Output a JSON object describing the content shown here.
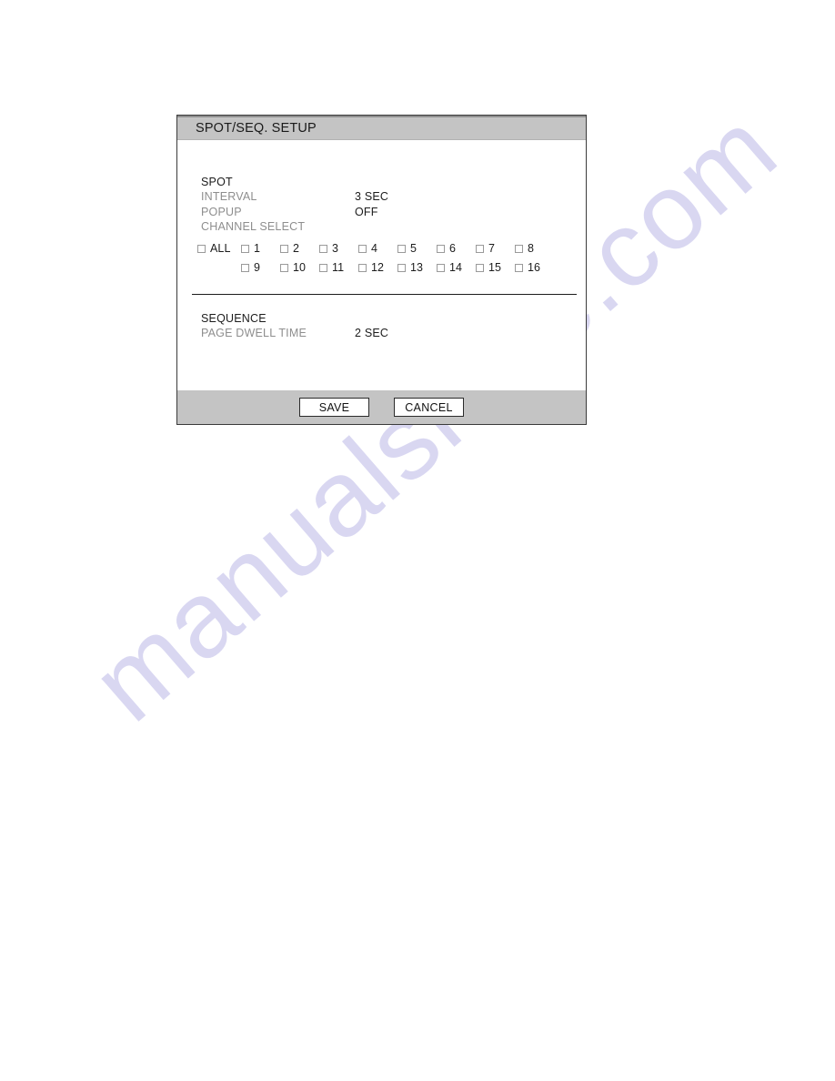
{
  "page": {
    "watermark": "manualshive.com"
  },
  "dialog": {
    "title": "SPOT/SEQ. SETUP",
    "spot_section": {
      "heading": "SPOT",
      "fields": [
        {
          "label": "INTERVAL",
          "value": "3 SEC"
        },
        {
          "label": "POPUP",
          "value": "OFF"
        }
      ],
      "channel_select_label": "CHANNEL SELECT",
      "channels_row1": [
        {
          "label": "ALL",
          "checked": false
        },
        {
          "label": "1",
          "checked": false
        },
        {
          "label": "2",
          "checked": false
        },
        {
          "label": "3",
          "checked": false
        },
        {
          "label": "4",
          "checked": false
        },
        {
          "label": "5",
          "checked": false
        },
        {
          "label": "6",
          "checked": false
        },
        {
          "label": "7",
          "checked": false
        },
        {
          "label": "8",
          "checked": false
        }
      ],
      "channels_row2": [
        {
          "label": "9",
          "checked": false
        },
        {
          "label": "10",
          "checked": false
        },
        {
          "label": "11",
          "checked": false
        },
        {
          "label": "12",
          "checked": false
        },
        {
          "label": "13",
          "checked": false
        },
        {
          "label": "14",
          "checked": false
        },
        {
          "label": "15",
          "checked": false
        },
        {
          "label": "16",
          "checked": false
        }
      ]
    },
    "sequence_section": {
      "heading": "SEQUENCE",
      "fields": [
        {
          "label": "PAGE DWELL TIME",
          "value": "2 SEC"
        }
      ]
    },
    "footer": {
      "save_label": "SAVE",
      "cancel_label": "CANCEL"
    }
  },
  "colors": {
    "titlebar_bg": "#c4c4c4",
    "footer_bg": "#c4c4c4",
    "label_gray": "#8e8e8e",
    "value_dark": "#1c1c1c",
    "watermark": "#c3c0ea"
  }
}
